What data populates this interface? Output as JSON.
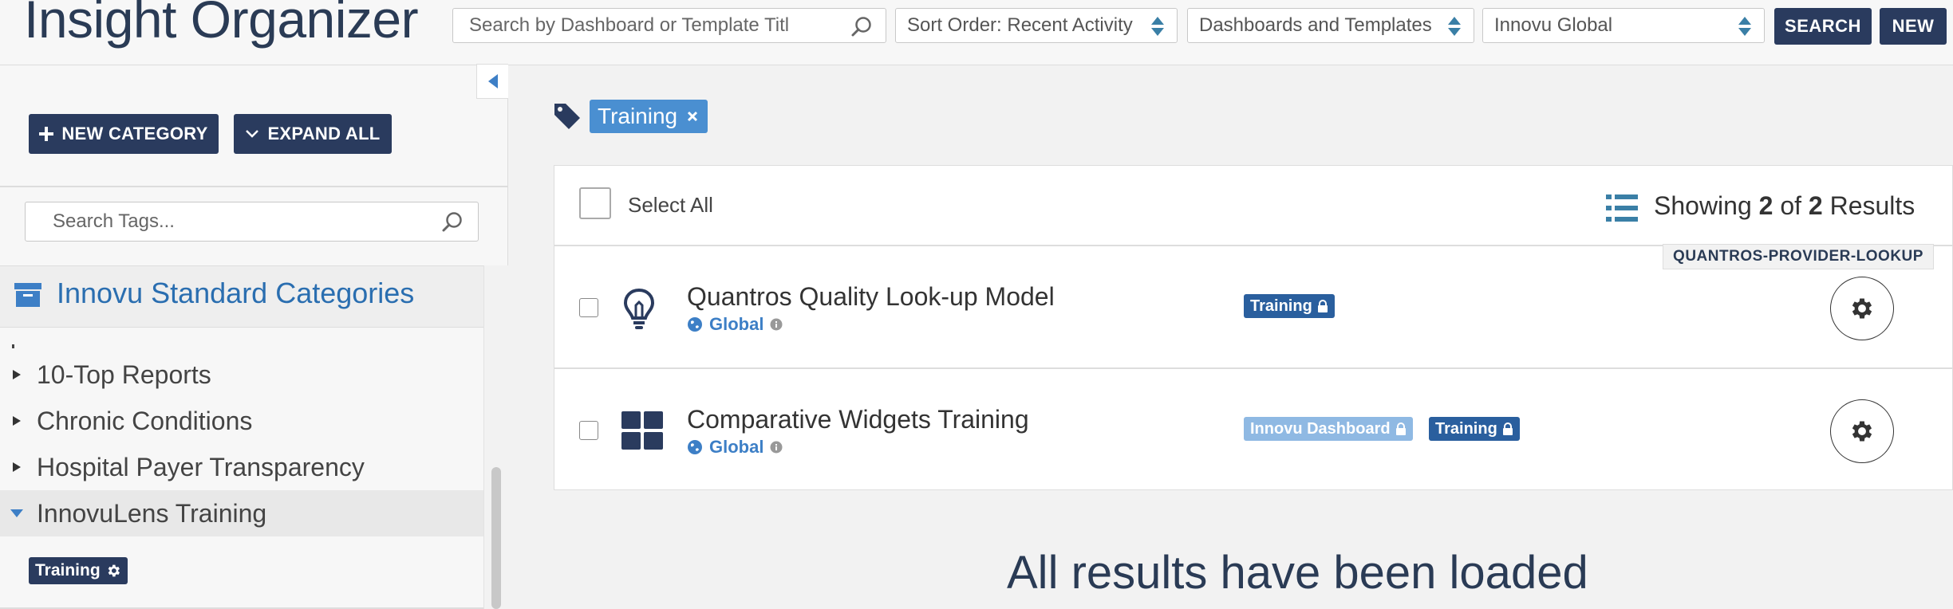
{
  "header": {
    "app_title": "Insight Organizer",
    "search_placeholder": "Search by Dashboard or Template Titl",
    "sort_label": "Sort Order: Recent Activity",
    "type_label": "Dashboards and Templates",
    "org_label": "Innovu Global",
    "search_button": "SEARCH",
    "new_button": "NEW"
  },
  "sidebar": {
    "new_category_button": "NEW CATEGORY",
    "expand_all_button": "EXPAND ALL",
    "tag_search_placeholder": "Search Tags...",
    "category_group_title": "Innovu Standard Categories",
    "items": [
      {
        "label": "10-Top Reports",
        "expanded": false
      },
      {
        "label": "Chronic Conditions",
        "expanded": false
      },
      {
        "label": "Hospital Payer Transparency",
        "expanded": false
      },
      {
        "label": "InnovuLens Training",
        "expanded": true
      }
    ],
    "child_tag": "Training"
  },
  "main": {
    "active_filter": "Training",
    "select_all_label": "Select All",
    "showing_prefix": "Showing",
    "showing_count": "2",
    "showing_of": "of",
    "showing_total": "2",
    "showing_suffix": "Results",
    "results": [
      {
        "title": "Quantros Quality Look-up Model",
        "scope": "Global",
        "icon": "lightbulb-icon",
        "code": "QUANTROS-PROVIDER-LOOKUP",
        "badges": [
          {
            "label": "Training",
            "locked": true,
            "color": "#2a5f9e"
          }
        ]
      },
      {
        "title": "Comparative Widgets Training",
        "scope": "Global",
        "icon": "dashboard-grid-icon",
        "badges": [
          {
            "label": "Innovu Dashboard",
            "locked": true,
            "color": "#8fb9e3"
          },
          {
            "label": "Training",
            "locked": true,
            "color": "#2a5f9e"
          }
        ]
      }
    ],
    "loaded_message": "All results have been loaded"
  },
  "colors": {
    "navy": "#2a3b5e",
    "accent_blue": "#4a8fd1",
    "link_blue": "#3d7fc6",
    "badge_dark": "#2a5f9e",
    "badge_light": "#8fb9e3"
  }
}
